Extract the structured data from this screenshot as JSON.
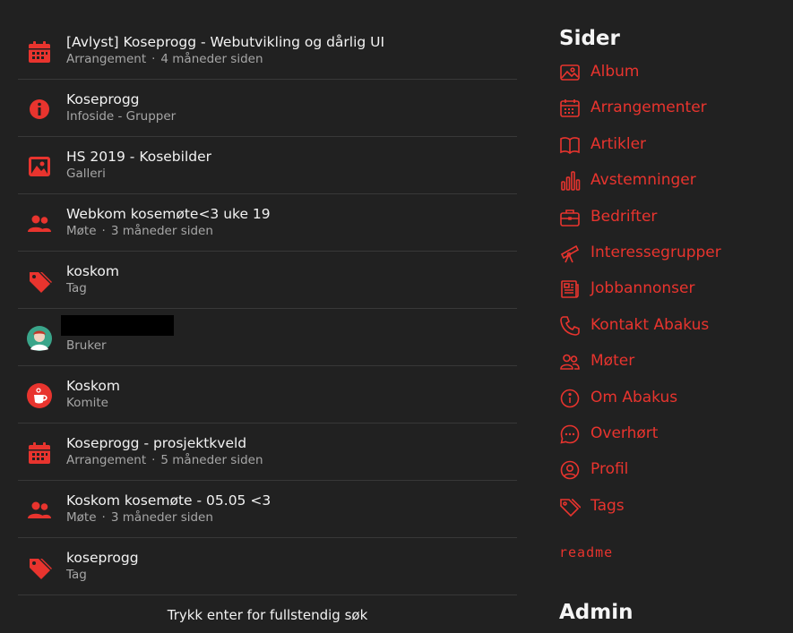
{
  "results": [
    {
      "title": "[Avlyst] Koseprogg - Webutvikling og dårlig UI",
      "type": "Arrangement",
      "time": "4 måneder siden",
      "icon": "calendar-icon"
    },
    {
      "title": "Koseprogg",
      "type": "Infoside - Grupper",
      "time": "",
      "icon": "info-icon"
    },
    {
      "title": "HS 2019 - Kosebilder",
      "type": "Galleri",
      "time": "",
      "icon": "image-icon"
    },
    {
      "title": "Webkom kosemøte<3 uke 19",
      "type": "Møte",
      "time": "3 måneder siden",
      "icon": "people-icon"
    },
    {
      "title": "koskom",
      "type": "Tag",
      "time": "",
      "icon": "tag-icon"
    },
    {
      "title": "",
      "type": "Bruker",
      "time": "",
      "icon": "avatar"
    },
    {
      "title": "Koskom",
      "type": "Komite",
      "time": "",
      "icon": "koskom-logo"
    },
    {
      "title": "Koseprogg - prosjektkveld",
      "type": "Arrangement",
      "time": "5 måneder siden",
      "icon": "calendar-icon"
    },
    {
      "title": "Koskom kosemøte - 05.05 <3",
      "type": "Møte",
      "time": "3 måneder siden",
      "icon": "people-icon"
    },
    {
      "title": "koseprogg",
      "type": "Tag",
      "time": "",
      "icon": "tag-icon"
    }
  ],
  "hint": "Trykk enter for fullstendig søk",
  "sidebar": {
    "heading": "Sider",
    "items": [
      {
        "label": "Album",
        "icon": "image-icon"
      },
      {
        "label": "Arrangementer",
        "icon": "calendar-icon"
      },
      {
        "label": "Artikler",
        "icon": "book-icon"
      },
      {
        "label": "Avstemninger",
        "icon": "bar-chart-icon"
      },
      {
        "label": "Bedrifter",
        "icon": "briefcase-icon"
      },
      {
        "label": "Interessegrupper",
        "icon": "telescope-icon"
      },
      {
        "label": "Jobbannonser",
        "icon": "newspaper-icon"
      },
      {
        "label": "Kontakt Abakus",
        "icon": "phone-icon"
      },
      {
        "label": "Møter",
        "icon": "people-icon"
      },
      {
        "label": "Om Abakus",
        "icon": "info-icon"
      },
      {
        "label": "Overhørt",
        "icon": "chat-bubble-icon"
      },
      {
        "label": "Profil",
        "icon": "user-circle-icon"
      },
      {
        "label": "Tags",
        "icon": "tag-icon"
      }
    ],
    "readme": "readme",
    "admin_heading": "Admin"
  },
  "colors": {
    "accent": "#e8342e",
    "background": "#212121",
    "muted": "#a6a6a6"
  }
}
